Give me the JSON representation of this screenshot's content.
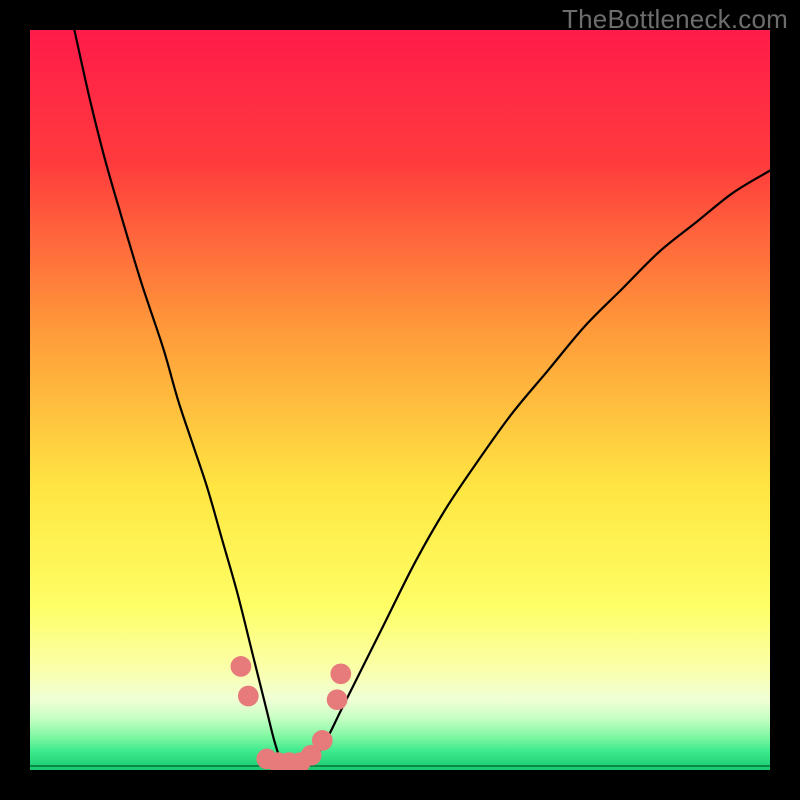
{
  "watermark": "TheBottleneck.com",
  "chart_data": {
    "type": "line",
    "title": "",
    "xlabel": "",
    "ylabel": "",
    "xlim": [
      0,
      100
    ],
    "ylim": [
      0,
      100
    ],
    "grid": false,
    "legend": false,
    "series": [
      {
        "name": "bottleneck-curve",
        "color": "#000000",
        "x": [
          6,
          8,
          10,
          12,
          15,
          18,
          20,
          22,
          24,
          26,
          28,
          30,
          31,
          32,
          33,
          34,
          35,
          36,
          38,
          40,
          42,
          45,
          48,
          52,
          56,
          60,
          65,
          70,
          75,
          80,
          85,
          90,
          95,
          100
        ],
        "y": [
          100,
          91,
          83,
          76,
          66,
          57,
          50,
          44,
          38,
          31,
          24,
          16,
          12,
          8,
          4,
          1,
          0,
          0,
          1,
          4,
          8,
          14,
          20,
          28,
          35,
          41,
          48,
          54,
          60,
          65,
          70,
          74,
          78,
          81
        ]
      }
    ],
    "markers": {
      "name": "highlight-points",
      "color": "#e77b7b",
      "radius_pct": 1.4,
      "points": [
        {
          "x": 28.5,
          "y": 14
        },
        {
          "x": 29.5,
          "y": 10
        },
        {
          "x": 32.0,
          "y": 1.5
        },
        {
          "x": 33.5,
          "y": 1.0
        },
        {
          "x": 35.0,
          "y": 1.0
        },
        {
          "x": 36.5,
          "y": 1.0
        },
        {
          "x": 38.0,
          "y": 2.0
        },
        {
          "x": 39.5,
          "y": 4.0
        },
        {
          "x": 41.5,
          "y": 9.5
        },
        {
          "x": 42.0,
          "y": 13.0
        }
      ]
    },
    "background_gradient": {
      "stops": [
        {
          "pos": 0.0,
          "color": "#ff1b4a"
        },
        {
          "pos": 0.18,
          "color": "#ff3b3d"
        },
        {
          "pos": 0.4,
          "color": "#ff983a"
        },
        {
          "pos": 0.62,
          "color": "#ffe642"
        },
        {
          "pos": 0.78,
          "color": "#feff66"
        },
        {
          "pos": 0.86,
          "color": "#fbffa7"
        },
        {
          "pos": 0.905,
          "color": "#f0ffd6"
        },
        {
          "pos": 0.93,
          "color": "#c7ffc4"
        },
        {
          "pos": 0.955,
          "color": "#80f7a2"
        },
        {
          "pos": 0.975,
          "color": "#3de98d"
        },
        {
          "pos": 1.0,
          "color": "#18c96f"
        }
      ]
    }
  }
}
